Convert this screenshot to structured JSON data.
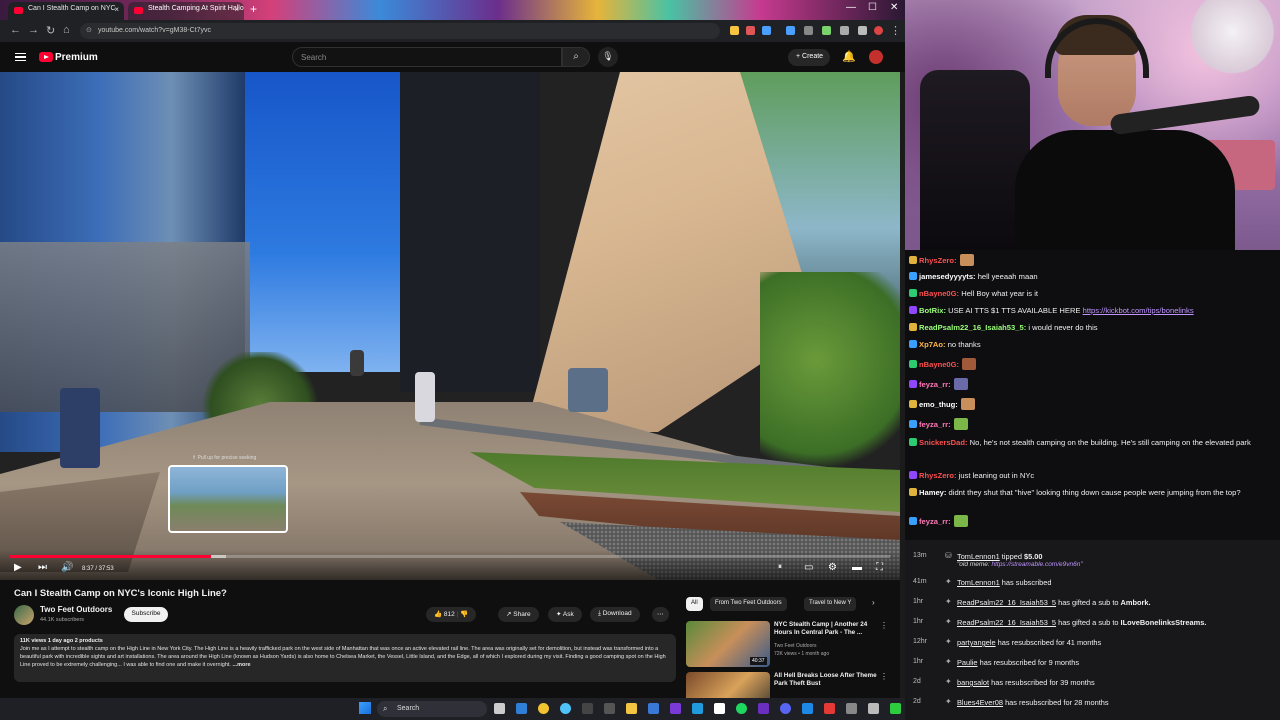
{
  "browser": {
    "tabs": [
      {
        "title": "Can I Stealth Camp on NYC"
      },
      {
        "title": "Stealth Camping At Spirit Hallo"
      }
    ],
    "url": "youtube.com/watch?v=gM38-Ct7yvc"
  },
  "youtube": {
    "brand": "Premium",
    "search_placeholder": "Search",
    "create_label": "Create"
  },
  "player": {
    "time": "8:37 / 37:53",
    "preview_tip": "⇑ Pull up for precise seeking",
    "progress_played_fraction": 0.228,
    "buffered_fraction": 0.245
  },
  "video": {
    "title": "Can I Stealth Camp on NYC's Iconic High Line?",
    "channel": "Two Feet Outdoors",
    "subscribers": "44.1K subscribers",
    "subscribe_label": "Subscribe",
    "likes": "812",
    "share_label": "Share",
    "ask_label": "Ask",
    "download_label": "Download",
    "desc_meta": "11K views  1 day ago  2 products",
    "desc_text": "Join me as I attempt to stealth camp on the High Line in New York City. The High Line is a heavily trafficked park on the west side of Manhattan that was once an active elevated rail line. The area was originally set for demolition, but instead was transformed into a beautiful park with incredible sights and art installations. The area around the High Line (known as Hudson Yards) is also home to Chelsea Market, the Vessel, Little Island, and the Edge, all of which I explored during my visit. Finding a good camping spot on the High Line proved to be extremely challenging... I was able to find one and make it overnight.",
    "more_label": "...more"
  },
  "sidebar": {
    "chips": [
      "All",
      "From Two Feet Outdoors",
      "Travel to New Y"
    ],
    "recs": [
      {
        "title": "NYC Stealth Camp | Another 24 Hours In Central Park - The ...",
        "channel": "Two Feet Outdoors",
        "meta": "72K views • 1 month ago",
        "duration": "40:37"
      },
      {
        "title": "All Hell Breaks Loose After Theme Park Theft Bust",
        "channel": "",
        "meta": "",
        "duration": ""
      }
    ]
  },
  "taskbar": {
    "search_label": "Search"
  },
  "chat": {
    "messages": [
      {
        "user": "RhysZero:",
        "text": "",
        "color": "#ff4f4f",
        "emote": true
      },
      {
        "user": "jamesedyyyyts:",
        "text": " hell yeeaah maan",
        "color": "#ffffff"
      },
      {
        "user": "nBayne0G:",
        "text": " Hell Boy what year is it",
        "color": "#ff4f4f"
      },
      {
        "user": "BotRix:",
        "text": " USE AI TTS $1 TTS AVAILABLE HERE ",
        "link": "https://kickbot.com/tips/bonelinks",
        "color": "#9bff7a"
      },
      {
        "user": "ReadPsalm22_16_Isaiah53_5:",
        "text": " i would never do this",
        "color": "#9bff7a"
      },
      {
        "user": "Xp7Ao:",
        "text": " no thanks",
        "color": "#ffb84d"
      },
      {
        "user": "nBayne0G:",
        "text": "",
        "color": "#ff4f4f",
        "emote": true
      },
      {
        "user": "feyza_rr:",
        "text": "",
        "color": "#ff7ab6",
        "emote": true
      },
      {
        "user": "emo_thug:",
        "text": "",
        "color": "#ffffff",
        "emote": true
      },
      {
        "user": "feyza_rr:",
        "text": "",
        "color": "#ff7ab6",
        "emote": true
      },
      {
        "user": "SnickersDad:",
        "text": " No, he's not stealth camping on the building. He's still camping on the elevated park",
        "color": "#ff4f4f"
      },
      {
        "user": "RhysZero:",
        "text": " just leaning out in NYc",
        "color": "#ff4f4f"
      },
      {
        "user": "Hamey:",
        "text": " didnt they shut that \"hive\" looking thing down cause people were jumping from the top?",
        "color": "#ffffff"
      },
      {
        "user": "feyza_rr:",
        "text": "",
        "color": "#ff7ab6",
        "emote": true
      }
    ]
  },
  "feed": {
    "events": [
      {
        "time": "13m",
        "name": "TomLennon1",
        "text": " tipped ",
        "amount": "$5.00",
        "quote": "\"old meme: ",
        "quote_link": "https://streamable.com/e9vn6n\""
      },
      {
        "time": "41m",
        "name": "TomLennon1",
        "text": " has subscribed"
      },
      {
        "time": "1hr",
        "name": "ReadPsalm22_16_Isaiah53_5",
        "text": " has gifted a sub to ",
        "target": "Ambork."
      },
      {
        "time": "1hr",
        "name": "ReadPsalm22_16_Isaiah53_5",
        "text": " has gifted a sub to ",
        "target": "ILoveBonelinksStreams."
      },
      {
        "time": "12hr",
        "name": "partyangele",
        "text": " has resubscribed for 41 months"
      },
      {
        "time": "1hr",
        "name": "Paulie",
        "text": " has resubscribed for 9 months"
      },
      {
        "time": "2d",
        "name": "bangsalot",
        "text": " has resubscribed for 39 months"
      },
      {
        "time": "2d",
        "name": "Blues4Ever08",
        "text": " has resubscribed for 28 months"
      }
    ]
  }
}
